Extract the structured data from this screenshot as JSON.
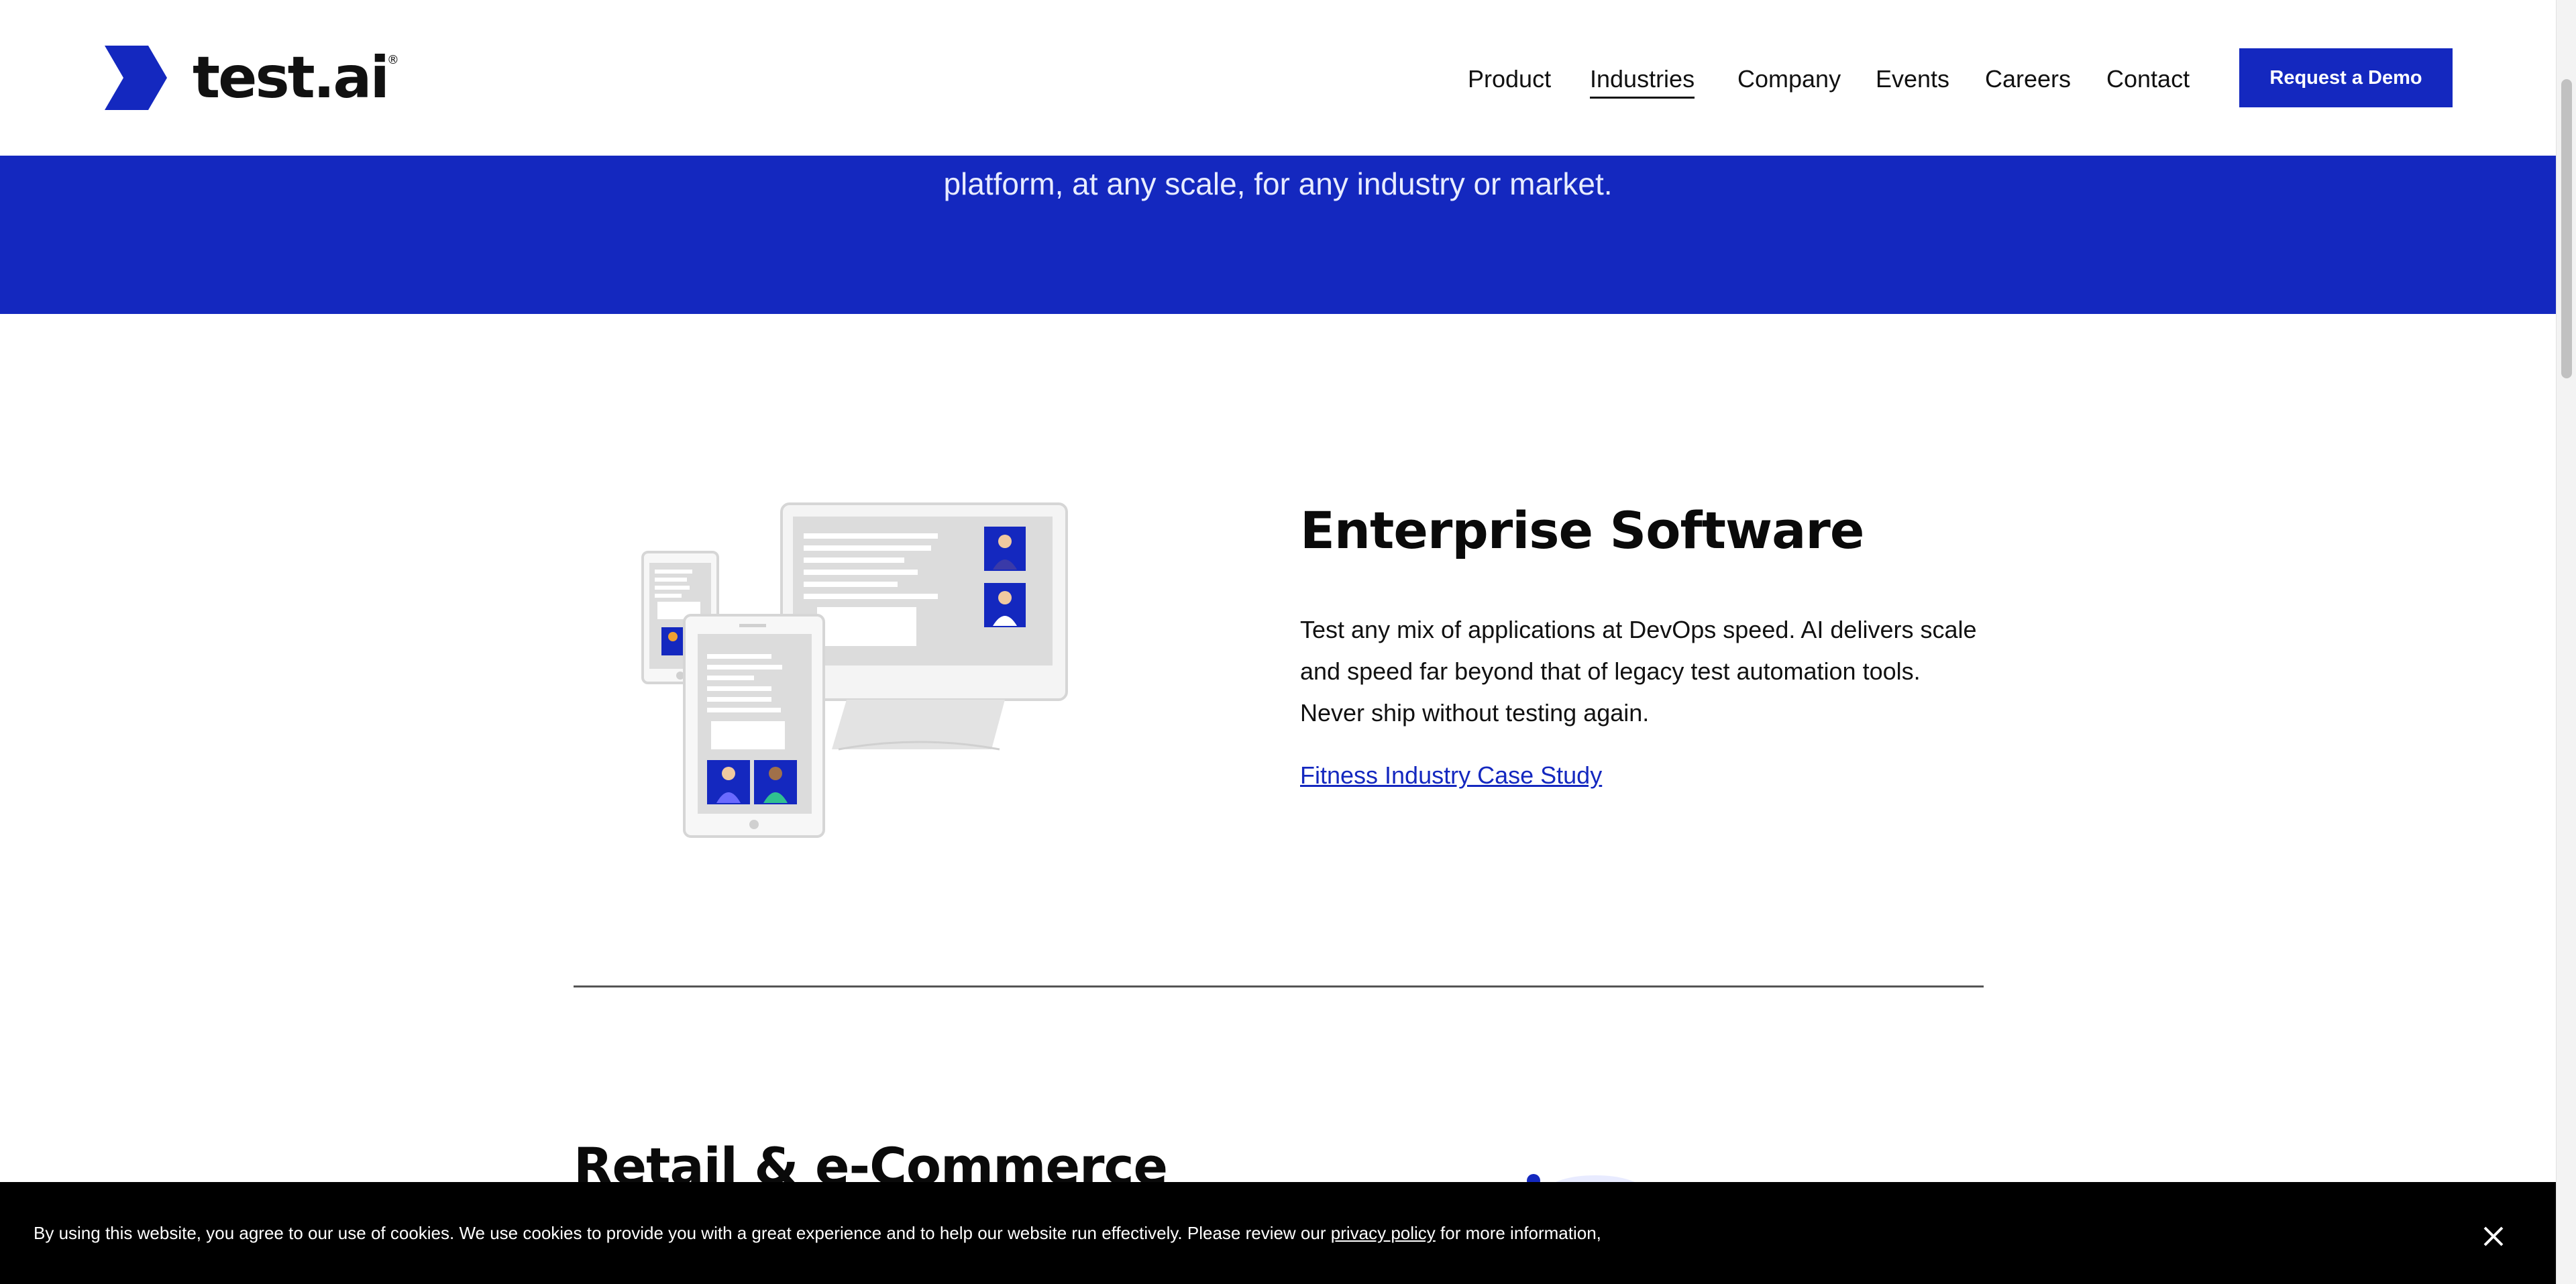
{
  "header": {
    "logo_text": "test.ai",
    "logo_reg": "®",
    "nav": [
      "Product",
      "Industries",
      "Company",
      "Events",
      "Careers",
      "Contact"
    ],
    "active_nav": "Industries",
    "cta_label": "Request a Demo"
  },
  "hero": {
    "text": "platform, at any scale, for any industry or market."
  },
  "enterprise": {
    "title": "Enterprise Software",
    "body": "Test any mix of applications at DevOps speed. AI delivers scale and speed far beyond that of legacy test automation tools. Never ship without testing again.",
    "link": "Fitness Industry Case Study",
    "illustration_icon": "devices-illustration"
  },
  "retail": {
    "title": "Retail & e-Commerce"
  },
  "cookie": {
    "text_before": "By using this website, you agree to our use of cookies. We use cookies to provide you with a great experience and to help our website run effectively. Please review our ",
    "link": "privacy policy",
    "text_after": " for more information,",
    "close_icon": "close-icon"
  },
  "colors": {
    "brand_blue": "#1428bf",
    "text": "#111111",
    "cookie_bg": "#000000"
  }
}
